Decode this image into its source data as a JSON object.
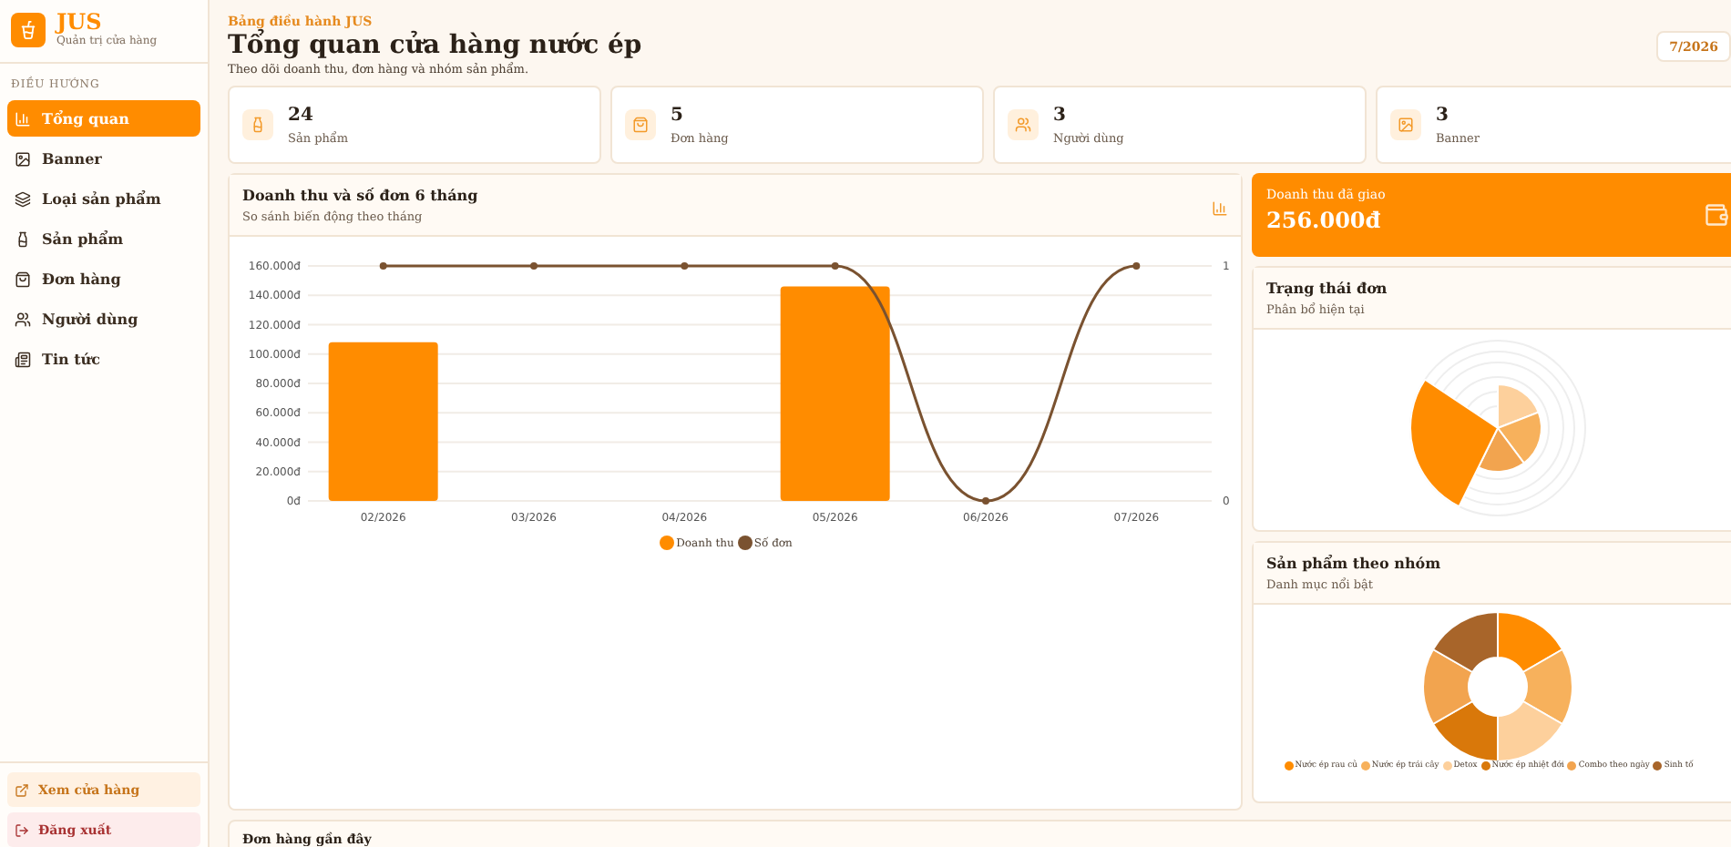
{
  "brand": {
    "name": "JUS",
    "subtitle": "Quản trị cửa hàng"
  },
  "sidebar": {
    "section": "ĐIỀU HƯỚNG",
    "items": [
      {
        "label": "Tổng quan",
        "selected": true
      },
      {
        "label": "Banner",
        "selected": false
      },
      {
        "label": "Loại sản phẩm",
        "selected": false
      },
      {
        "label": "Sản phẩm",
        "selected": false
      },
      {
        "label": "Đơn hàng",
        "selected": false
      },
      {
        "label": "Người dùng",
        "selected": false
      },
      {
        "label": "Tin tức",
        "selected": false
      }
    ],
    "footer": [
      {
        "label": "Xem cửa hàng",
        "kind": "link"
      },
      {
        "label": "Đăng xuất",
        "kind": "danger"
      }
    ]
  },
  "header": {
    "eyebrow": "Bảng điều hành JUS",
    "title": "Tổng quan cửa hàng nước ép",
    "subtitle": "Theo dõi doanh thu, đơn hàng và nhóm sản phẩm.",
    "date": "7/2026"
  },
  "stats": [
    {
      "value": "24",
      "label": "Sản phẩm"
    },
    {
      "value": "5",
      "label": "Đơn hàng"
    },
    {
      "value": "3",
      "label": "Người dùng"
    },
    {
      "value": "3",
      "label": "Banner"
    }
  ],
  "main_chart": {
    "title": "Doanh thu và số đơn 6 tháng",
    "subtitle": "So sánh biến động theo tháng",
    "chart_data": {
      "type": "bar",
      "categories": [
        "02/2026",
        "03/2026",
        "04/2026",
        "05/2026",
        "06/2026",
        "07/2026"
      ],
      "series": [
        {
          "name": "Doanh thu",
          "color": "#ff8c00",
          "values": [
            108000,
            0,
            0,
            146000,
            0,
            0
          ]
        },
        {
          "name": "Số đơn",
          "color": "#7a5230",
          "type": "line",
          "axis": "y2",
          "marker": "circle",
          "values": [
            1,
            1,
            1,
            1,
            0,
            1
          ]
        }
      ],
      "grid": true,
      "y2lim": [
        0,
        1
      ],
      "ylim": [
        0,
        160000
      ],
      "yticks": [
        {
          "value": 0,
          "label": "0đ"
        },
        {
          "value": 20000,
          "label": "20.000đ"
        },
        {
          "value": 40000,
          "label": "40.000đ"
        },
        {
          "value": 60000,
          "label": "60.000đ"
        },
        {
          "value": 80000,
          "label": "80.000đ"
        },
        {
          "value": 100000,
          "label": "100.000đ"
        },
        {
          "value": 120000,
          "label": "120.000đ"
        },
        {
          "value": 140000,
          "label": "140.000đ"
        },
        {
          "value": 160000,
          "label": "160.000đ"
        }
      ],
      "y2ticks": [
        0,
        1
      ]
    }
  },
  "revenue": {
    "label": "Doanh thu đã giao",
    "value": "256.000đ"
  },
  "status_chart": {
    "title": "Trạng thái đơn",
    "subtitle": "Phân bổ hiện tại"
  },
  "category_chart": {
    "title": "Sản phẩm theo nhóm",
    "subtitle": "Danh mục nổi bật",
    "legend": [
      {
        "label": "Nước ép rau củ",
        "color": "#ff8c00"
      },
      {
        "label": "Nước ép trái cây",
        "color": "#f7b15c"
      },
      {
        "label": "Detox",
        "color": "#fdd09c"
      },
      {
        "label": "Nước ép nhiệt đới",
        "color": "#d9780a"
      },
      {
        "label": "Combo theo ngày",
        "color": "#f2a44f"
      },
      {
        "label": "Sinh tố",
        "color": "#a8652a"
      }
    ]
  },
  "recent": {
    "title": "Đơn hàng gần đây"
  }
}
